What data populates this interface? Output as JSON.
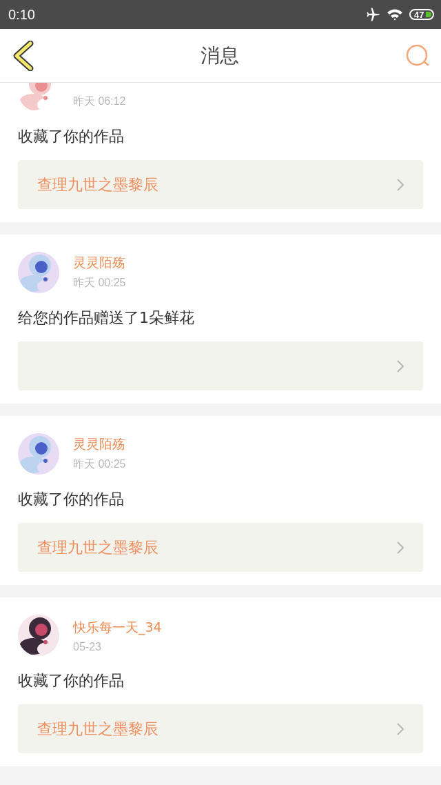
{
  "status_bar": {
    "time": "0:10",
    "battery": "47"
  },
  "header": {
    "title": "消息"
  },
  "messages": [
    {
      "time": "昨天 06:12",
      "action": "收藏了你的作品",
      "work": "查理九世之墨黎辰"
    },
    {
      "name": "灵灵陌殇",
      "time": "昨天 00:25",
      "action": "给您的作品赠送了1朵鲜花"
    },
    {
      "name": "灵灵陌殇",
      "time": "昨天 00:25",
      "action": "收藏了你的作品",
      "work": "查理九世之墨黎辰"
    },
    {
      "name": "快乐每一天_34",
      "time": "05-23",
      "action": "收藏了你的作品",
      "work": "查理九世之墨黎辰"
    }
  ]
}
